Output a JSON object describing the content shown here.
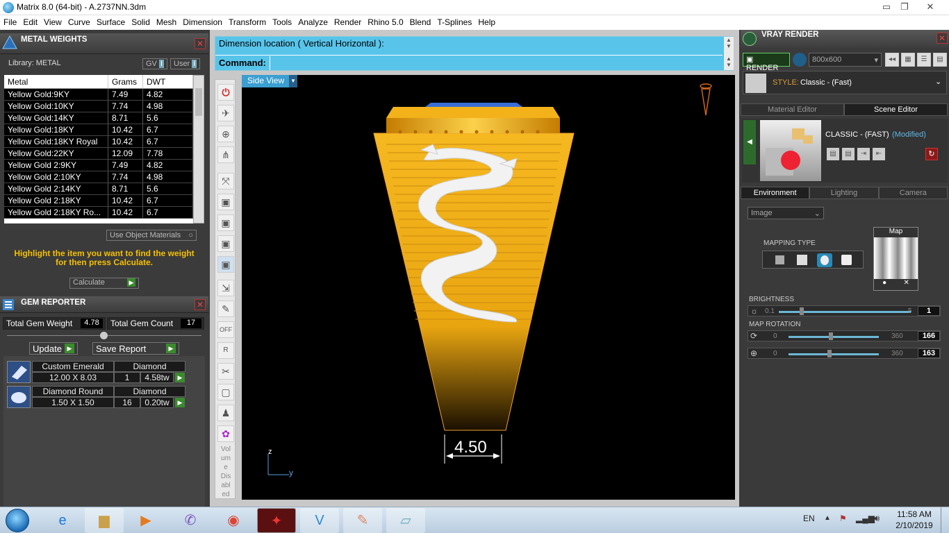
{
  "window": {
    "title": "Matrix 8.0 (64-bit) - A.2737NN.3dm",
    "minimize": "▭",
    "restore": "❐",
    "close": "✕"
  },
  "menu": [
    "File",
    "Edit",
    "View",
    "Curve",
    "Surface",
    "Solid",
    "Mesh",
    "Dimension",
    "Transform",
    "Tools",
    "Analyze",
    "Render",
    "Rhino 5.0",
    "Blend",
    "T-Splines",
    "Help"
  ],
  "metal_weights": {
    "title": "METAL WEIGHTS",
    "library": "Library: METAL",
    "gv_label": "GV",
    "user_label": "User",
    "columns": [
      "Metal",
      "Grams",
      "DWT"
    ],
    "rows": [
      [
        "Yellow Gold:9KY",
        "7.49",
        "4.82"
      ],
      [
        "Yellow Gold:10KY",
        "7.74",
        "4.98"
      ],
      [
        "Yellow Gold:14KY",
        "8.71",
        "5.6"
      ],
      [
        "Yellow Gold:18KY",
        "10.42",
        "6.7"
      ],
      [
        "Yellow Gold:18KY Royal",
        "10.42",
        "6.7"
      ],
      [
        "Yellow Gold:22KY",
        "12.09",
        "7.78"
      ],
      [
        "Yellow Gold 2:9KY",
        "7.49",
        "4.82"
      ],
      [
        "Yellow Gold 2:10KY",
        "7.74",
        "4.98"
      ],
      [
        "Yellow Gold 2:14KY",
        "8.71",
        "5.6"
      ],
      [
        "Yellow Gold 2:18KY",
        "10.42",
        "6.7"
      ],
      [
        "Yellow Gold 2:18KY Ro...",
        "10.42",
        "6.7"
      ]
    ],
    "use_object_materials": "Use Object Materials",
    "hint": "Highlight the item you want to find the weight for then press Calculate.",
    "calculate": "Calculate"
  },
  "gem_reporter": {
    "title": "GEM REPORTER",
    "total_weight_label": "Total Gem Weight",
    "total_weight": "4.78",
    "total_count_label": "Total Gem Count",
    "total_count": "17",
    "update": "Update",
    "save_report": "Save Report",
    "gems": [
      {
        "shape": "Custom Emerald",
        "type": "Diamond",
        "size": "12.00 X 8.03",
        "qty": "1",
        "weight": "4.58tw"
      },
      {
        "shape": "Diamond Round",
        "type": "Diamond",
        "size": "1.50 X 1.50",
        "qty": "16",
        "weight": "0.20tw"
      }
    ]
  },
  "command": {
    "prompt": "Dimension location ( Vertical  Horizontal ):",
    "label": "Command:"
  },
  "viewport": {
    "tab": "Side View",
    "dimension": "4.50",
    "axis_z": "z",
    "axis_y": "y"
  },
  "vtool_footer": [
    "Vol",
    "um",
    "e",
    "Dis",
    "abl",
    "ed"
  ],
  "vray": {
    "title": "VRAY RENDER",
    "render_btn": "RENDER",
    "resolution": "800x600",
    "style_label": "STYLE:",
    "style_value": "Classic - (Fast)",
    "tabs": [
      "Material Editor",
      "Scene Editor"
    ],
    "scene_name": "CLASSIC - (FAST)",
    "modified": "(Modified)",
    "env_tabs": [
      "Environment",
      "Lighting",
      "Camera"
    ],
    "env_type": "Image",
    "mapping_type": "MAPPING TYPE",
    "map_label": "Map",
    "brightness_label": "BRIGHTNESS",
    "brightness_min": "0.1",
    "brightness_max": "5",
    "brightness_val": "1",
    "rotation_label": "MAP ROTATION",
    "rot1_min": "0",
    "rot1_max": "360",
    "rot1_val": "166",
    "rot2_min": "0",
    "rot2_max": "360",
    "rot2_val": "163"
  },
  "taskbar": {
    "lang": "EN",
    "time": "11:58 AM",
    "date": "2/10/2019"
  }
}
